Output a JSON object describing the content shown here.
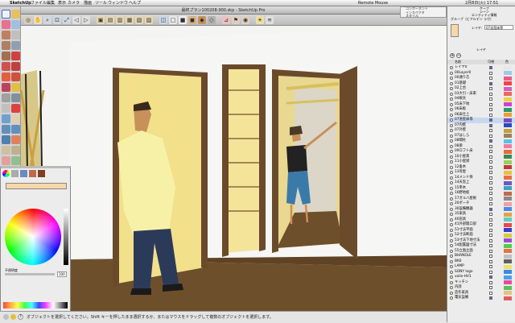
{
  "menubar": {
    "items": [
      "SketchUp",
      "ファイル",
      "編集",
      "表示",
      "カメラ",
      "描画",
      "ツール",
      "ウィンドウ",
      "ヘルプ"
    ],
    "remote_mouse": "Remote Mouse",
    "clock": "2月8日(火)  17:51"
  },
  "window": {
    "title": "最終プラン100208-900.skp - SketchUp Pro"
  },
  "popup": {
    "items": [
      "コンポーネント",
      "インスペクタ",
      "スタイル"
    ]
  },
  "status": {
    "text": "オブジェクトを選択してください。Shift キーを押したまま選択するか、またはマウスをドラッグして複数のオブジェクトを選択します。"
  },
  "colorpanel": {
    "opacity_label": "不透明度",
    "opacity_value": "100"
  },
  "rightpanel": {
    "tabs": [
      "ケーブ",
      "シーン",
      "エンティティ情報"
    ],
    "entity_label": "グループ（ビアルデン ラガ）",
    "layer_label": "レイヤ:",
    "layer_value": "07浴室床等",
    "layers_title": "レイヤ",
    "col_name": "名前",
    "col_visible": "可視",
    "col_color": "色"
  },
  "layers": [
    {
      "name": "レイヤ0",
      "color": "#e8e8e8",
      "visible": true
    },
    {
      "name": "00Layer0",
      "color": "#9ec9e8",
      "visible": false
    },
    {
      "name": "00通り芯",
      "color": "#e85a8a",
      "visible": false
    },
    {
      "name": "01基礎",
      "color": "#ee4444",
      "visible": true
    },
    {
      "name": "02上台",
      "color": "#d85ac0",
      "visible": false
    },
    {
      "name": "03大引・床束",
      "color": "#e86a5a",
      "visible": false
    },
    {
      "name": "04根太",
      "color": "#f0d040",
      "visible": false
    },
    {
      "name": "05床下地",
      "color": "#cc44cc",
      "visible": false
    },
    {
      "name": "06床板",
      "color": "#2a9a6a",
      "visible": false
    },
    {
      "name": "06床仕上",
      "color": "#e8a030",
      "visible": false
    },
    {
      "name": "07浴室床等",
      "color": "#7a4ac0",
      "visible": true
    },
    {
      "name": "07内壁",
      "color": "#2a4ac0",
      "visible": true
    },
    {
      "name": "07外壁",
      "color": "#c0a040",
      "visible": false
    },
    {
      "name": "07はしら",
      "color": "#a08050",
      "visible": false
    },
    {
      "name": "08間柱",
      "color": "#5ac0e8",
      "visible": true
    },
    {
      "name": "08梁",
      "color": "#f07aa0",
      "visible": false
    },
    {
      "name": "09ロフト床",
      "color": "#e86a3a",
      "visible": false
    },
    {
      "name": "10小屋束",
      "color": "#3a8a4a",
      "visible": false
    },
    {
      "name": "11小屋梁",
      "color": "#9ad05a",
      "visible": false
    },
    {
      "name": "12垂木",
      "color": "#c03a3a",
      "visible": false
    },
    {
      "name": "13母屋",
      "color": "#e8c040",
      "visible": false
    },
    {
      "name": "14メンド骨",
      "color": "#e87040",
      "visible": false
    },
    {
      "name": "14天窓上",
      "color": "#6a5ac0",
      "visible": false
    },
    {
      "name": "15単木",
      "color": "#40a0c0",
      "visible": false
    },
    {
      "name": "16野地板",
      "color": "#c06a4a",
      "visible": false
    },
    {
      "name": "17ガルバ屋根",
      "color": "#8a8a8a",
      "visible": false
    },
    {
      "name": "20ポーチ",
      "color": "#f0a0a0",
      "visible": false
    },
    {
      "name": "30設備機器",
      "color": "#4a8ae8",
      "visible": true
    },
    {
      "name": "35家具",
      "color": "#e8a040",
      "visible": false
    },
    {
      "name": "40窓具",
      "color": "#5ad0c0",
      "visible": false
    },
    {
      "name": "41外部開口部",
      "color": "#e84a4a",
      "visible": false
    },
    {
      "name": "51寸法平面",
      "color": "#3a3ad0",
      "visible": false
    },
    {
      "name": "52寸法断面",
      "color": "#d0d03a",
      "visible": false
    },
    {
      "name": "53寸法下地寸法",
      "color": "#a04ad0",
      "visible": false
    },
    {
      "name": "54配置図寸法",
      "color": "#4ad04a",
      "visible": false
    },
    {
      "name": "55立面立面",
      "color": "#e8704a",
      "visible": false
    },
    {
      "name": "BHANDLE",
      "color": "#c0c0c0",
      "visible": false
    },
    {
      "name": "BK0",
      "color": "#606060",
      "visible": false
    },
    {
      "name": "LAMP",
      "color": "#f0e060",
      "visible": false
    },
    {
      "name": "SONY logo",
      "color": "#3a8ae8",
      "visible": false
    },
    {
      "name": "voile-HV1",
      "color": "#4aa0e8",
      "visible": true
    },
    {
      "name": "キッチン",
      "color": "#e84a9a",
      "visible": false
    },
    {
      "name": "内部",
      "color": "#5ac05a",
      "visible": false
    },
    {
      "name": "造作家具",
      "color": "#e8c080",
      "visible": false
    },
    {
      "name": "電気設備",
      "color": "#e85a5a",
      "visible": true
    }
  ],
  "colors": {
    "wall": "#f4f4f2",
    "door_frame": "#6b4a2c",
    "floor": "#6e4f2c",
    "inner_yellow": "#f2e08a",
    "shirt": "#f7f1a8",
    "jeans": "#2c3a5a",
    "accent": "#3b6fd6"
  }
}
